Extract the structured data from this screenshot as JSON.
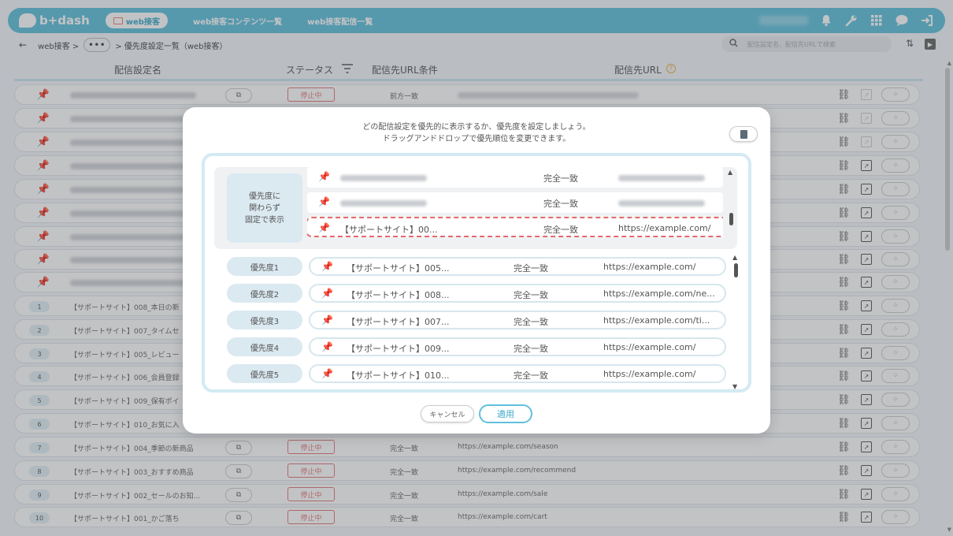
{
  "header": {
    "logo": "b+dash",
    "active_nav": "web接客",
    "nav_links": [
      "web接客コンテンツ一覧",
      "web接客配信一覧"
    ]
  },
  "breadcrumb": {
    "root": "web接客 >",
    "ellipsis": "•••",
    "current": "> 優先度設定一覧（web接客）"
  },
  "search": {
    "placeholder": "配信設定名、配信先URLで検索"
  },
  "table": {
    "columns": {
      "name": "配信設定名",
      "status": "ステータス",
      "condition": "配信先URL条件",
      "url": "配信先URL"
    },
    "first_row": {
      "status": "停止中",
      "match": "前方一致"
    },
    "rows": [
      {
        "num": "1",
        "name": "【サポートサイト】008_本日の新"
      },
      {
        "num": "2",
        "name": "【サポートサイト】007_タイムセ"
      },
      {
        "num": "3",
        "name": "【サポートサイト】005_レビュー"
      },
      {
        "num": "4",
        "name": "【サポートサイト】006_会員登録"
      },
      {
        "num": "5",
        "name": "【サポートサイト】009_保有ポイ"
      },
      {
        "num": "6",
        "name": "【サポートサイト】010_お気に入"
      },
      {
        "num": "7",
        "name": "【サポートサイト】004_季節の新商品",
        "status": "停止中",
        "match": "完全一致",
        "url": "https://example.com/season"
      },
      {
        "num": "8",
        "name": "【サポートサイト】003_おすすめ商品",
        "status": "停止中",
        "match": "完全一致",
        "url": "https://example.com/recommend"
      },
      {
        "num": "9",
        "name": "【サポートサイト】002_セールのお知...",
        "status": "停止中",
        "match": "完全一致",
        "url": "https://example.com/sale"
      },
      {
        "num": "10",
        "name": "【サポートサイト】001_かご落ち",
        "status": "停止中",
        "match": "完全一致",
        "url": "https://example.com/cart"
      }
    ]
  },
  "modal": {
    "instruction_line1": "どの配信設定を優先的に表示するか、優先度を設定しましょう。",
    "instruction_line2": "ドラッグアンドドロップで優先順位を変更できます。",
    "fixed_label_line1": "優先度に",
    "fixed_label_line2": "関わらず",
    "fixed_label_line3": "固定で表示",
    "fixed_rows": [
      {
        "match": "完全一致"
      },
      {
        "match": "完全一致"
      },
      {
        "title": "【サポートサイト】00...",
        "match": "完全一致",
        "url": "https://example.com/"
      }
    ],
    "priority_rows": [
      {
        "label": "優先度1",
        "title": "【サポートサイト】005...",
        "match": "完全一致",
        "url": "https://example.com/"
      },
      {
        "label": "優先度2",
        "title": "【サポートサイト】008...",
        "match": "完全一致",
        "url": "https://example.com/ne..."
      },
      {
        "label": "優先度3",
        "title": "【サポートサイト】007...",
        "match": "完全一致",
        "url": "https://example.com/ti..."
      },
      {
        "label": "優先度4",
        "title": "【サポートサイト】009...",
        "match": "完全一致",
        "url": "https://example.com/"
      },
      {
        "label": "優先度5",
        "title": "【サポートサイト】010...",
        "match": "完全一致",
        "url": "https://example.com/"
      }
    ],
    "cancel_label": "キャンセル",
    "apply_label": "適用"
  }
}
